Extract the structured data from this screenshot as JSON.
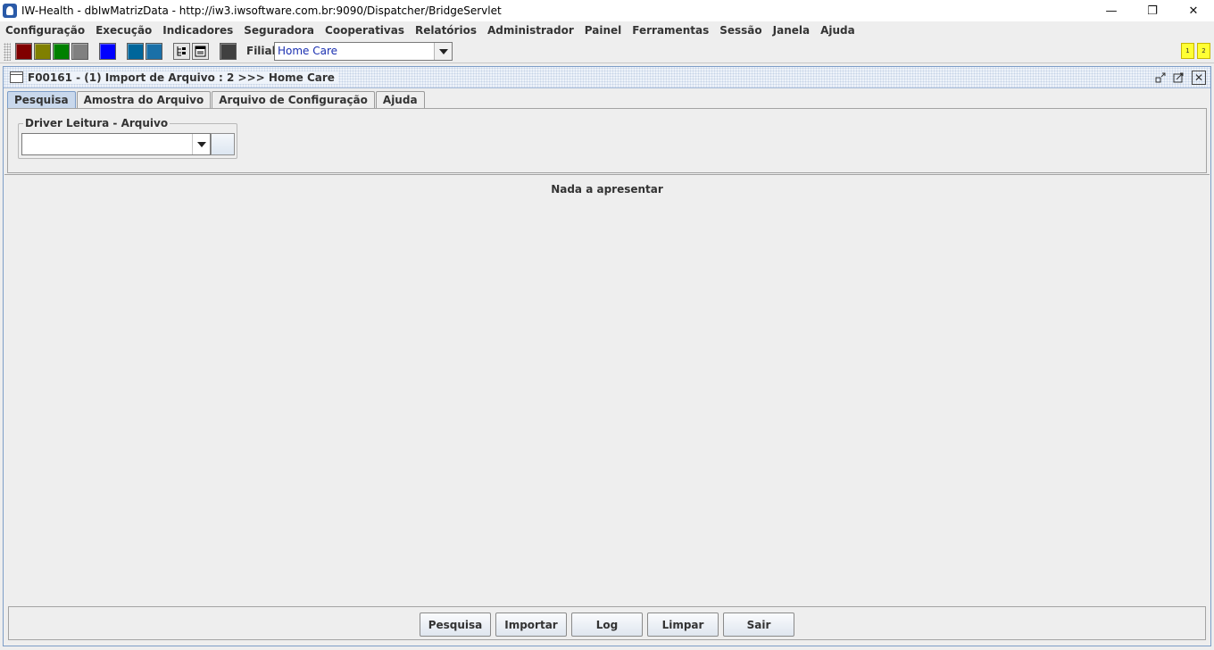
{
  "window": {
    "title": "IW-Health - dbIwMatrizData - http://iw3.iwsoftware.com.br:9090/Dispatcher/BridgeServlet",
    "minimize_glyph": "—",
    "restore_glyph": "❐",
    "close_glyph": "✕"
  },
  "menu": [
    "Configuração",
    "Execução",
    "Indicadores",
    "Seguradora",
    "Cooperativas",
    "Relatórios",
    "Administrador",
    "Painel",
    "Ferramentas",
    "Sessão",
    "Janela",
    "Ajuda"
  ],
  "toolbar": {
    "swatch_colors": [
      "#800000",
      "#808000",
      "#008000",
      "#808080",
      "#0000ff",
      "#00669b",
      "#1a70a8",
      "#404040"
    ],
    "filial_label": "Filial:",
    "filial_value": "Home Care",
    "badges": [
      "1",
      "2"
    ],
    "badge_color": "#ffff33"
  },
  "frame": {
    "title": "F00161 - (1) Import de Arquivo : 2 >>> Home Care",
    "tabs": [
      "Pesquisa",
      "Amostra do Arquivo",
      "Arquivo de Configuração",
      "Ajuda"
    ],
    "active_tab": "Pesquisa",
    "driver_group_label": "Driver Leitura - Arquivo",
    "driver_value": "",
    "empty_message": "Nada a apresentar",
    "buttons": [
      "Pesquisa",
      "Importar",
      "Log",
      "Limpar",
      "Sair"
    ]
  }
}
